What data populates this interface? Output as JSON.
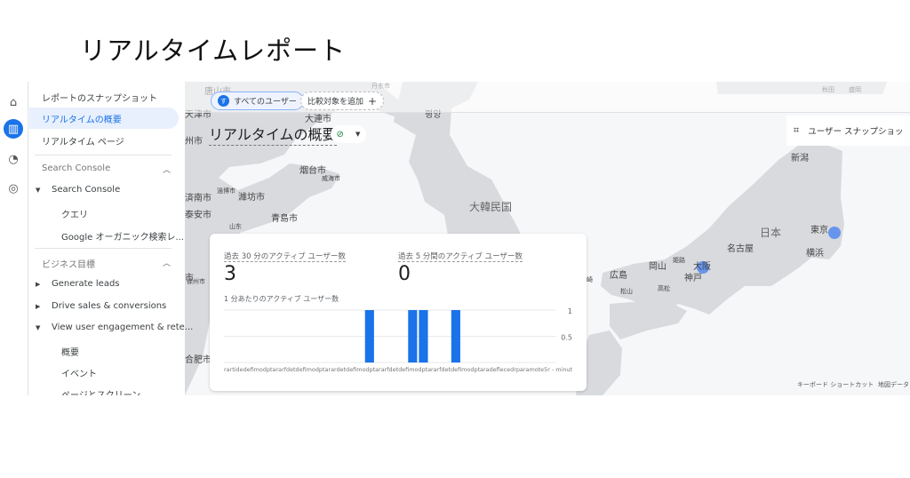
{
  "header": {
    "title": "リアルタイムレポート"
  },
  "rail": {
    "icons": [
      "home-icon",
      "reports-icon",
      "explore-icon",
      "advertising-icon"
    ]
  },
  "nav": {
    "items": [
      {
        "label": "レポートのスナップショット"
      },
      {
        "label": "リアルタイムの概要",
        "selected": true
      },
      {
        "label": "リアルタイム ページ"
      }
    ],
    "sections": [
      {
        "title": "Search Console",
        "groups": [
          {
            "label": "Search Console",
            "expanded": true,
            "children": [
              "クエリ",
              "Google オーガニック検索レ..."
            ]
          }
        ]
      },
      {
        "title": "ビジネス目標",
        "groups": [
          {
            "label": "Generate leads",
            "expanded": false
          },
          {
            "label": "Drive sales & conversions",
            "expanded": false
          },
          {
            "label": "View user engagement & rete...",
            "expanded": true,
            "children": [
              "概要",
              "イベント",
              "ページとスクリーン"
            ]
          }
        ]
      }
    ]
  },
  "toolbar": {
    "segment_chip": "すべてのユーザー",
    "segment_avatar": "す",
    "compare_chip": "比較対象を追加",
    "compare_plus": "+"
  },
  "report_title": "リアルタイムの概要",
  "snapshot_button": "ユーザー スナップショッ",
  "map": {
    "labels": [
      "唐山市",
      "丹东市",
      "天津市",
      "大連市",
      "평양",
      "州市",
      "烟台市",
      "威海市",
      "済南市",
      "淄博市",
      "濰坊市",
      "泰安市",
      "青島市",
      "山东",
      "大韓民国",
      "徐州市",
      "合肥市",
      "秋田",
      "盛岡",
      "新潟",
      "日本",
      "東京",
      "横浜",
      "名古屋",
      "岡山",
      "姫路",
      "大阪",
      "神戸",
      "広島",
      "高松",
      "松山",
      "市",
      "崎"
    ],
    "footer": [
      "キーボード ショートカット",
      "地図データ"
    ],
    "bubble_color": "#5b8def"
  },
  "card": {
    "metric1": {
      "label": "過去 30 分のアクティブ ユーザー数",
      "value": "3"
    },
    "metric2": {
      "label": "過去 5 分間のアクティブ ユーザー数",
      "value": "0"
    },
    "chart_title": "1 分あたりのアクティブ ユーザー数"
  },
  "chart_data": {
    "type": "bar",
    "title": "1 分あたりのアクティブ ユーザー数",
    "values": [
      0,
      0,
      0,
      0,
      0,
      0,
      0,
      0,
      0,
      0,
      0,
      0,
      0,
      1,
      0,
      0,
      0,
      1,
      1,
      0,
      0,
      1,
      0,
      0,
      0,
      0,
      0,
      0,
      0,
      0
    ],
    "ylim": [
      0,
      1
    ],
    "yticks": [
      "1",
      "0.5"
    ],
    "x_axis_text": "rartidedefimodptararfdetdefimodptarardetdefimodptararfdetdefimodptararfdetdefimodptaradeflecedrparamote5r - minut",
    "bar_color": "#1a73e8",
    "grid": true
  }
}
